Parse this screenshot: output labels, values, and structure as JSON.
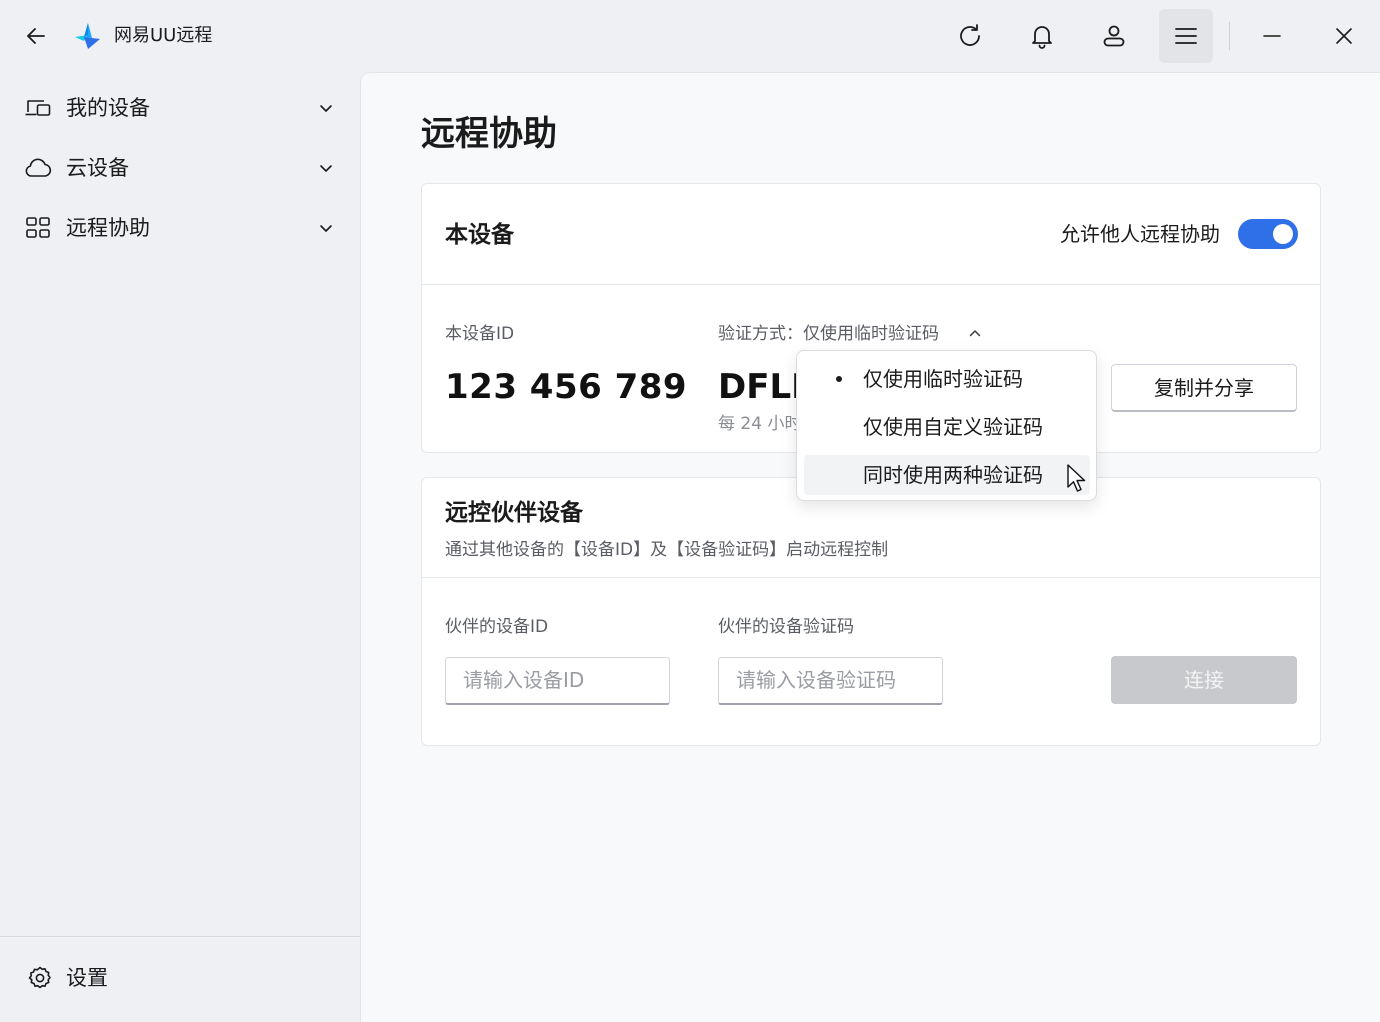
{
  "titlebar": {
    "app_name": "网易UU远程",
    "icons": [
      "back-arrow-icon",
      "refresh-icon",
      "bell-icon",
      "user-icon",
      "menu-icon",
      "minimize-icon",
      "close-icon"
    ]
  },
  "sidebar": {
    "items": [
      {
        "label": "我的设备",
        "icon": "devices-icon"
      },
      {
        "label": "云设备",
        "icon": "cloud-icon"
      },
      {
        "label": "远程协助",
        "icon": "remote-assist-icon"
      }
    ],
    "settings_label": "设置"
  },
  "main": {
    "title": "远程协助",
    "this_device": {
      "title": "本设备",
      "allow_label": "允许他人远程协助",
      "allow_enabled": true,
      "id_label": "本设备ID",
      "device_id": "123 456 789",
      "verify_label": "验证方式：仅使用临时验证码",
      "verify_code_visible": "DFLK",
      "refresh_note_visible": "每 24 小时",
      "copy_button": "复制并分享"
    },
    "partner": {
      "title": "远控伙伴设备",
      "subtitle": "通过其他设备的【设备ID】及【设备验证码】启动远程控制",
      "id_label": "伙伴的设备ID",
      "id_placeholder": "请输入设备ID",
      "code_label": "伙伴的设备验证码",
      "code_placeholder": "请输入设备验证码",
      "connect_button": "连接"
    }
  },
  "dropdown": {
    "options": [
      {
        "label": "仅使用临时验证码",
        "selected": true
      },
      {
        "label": "仅使用自定义验证码",
        "selected": false
      },
      {
        "label": "同时使用两种验证码",
        "selected": false,
        "hovered": true
      }
    ]
  },
  "colors": {
    "accent": "#2f6fe8",
    "sidebar_bg": "#eef0f4",
    "content_bg": "#f8f9fb",
    "disabled_button": "#c8c9cc"
  }
}
